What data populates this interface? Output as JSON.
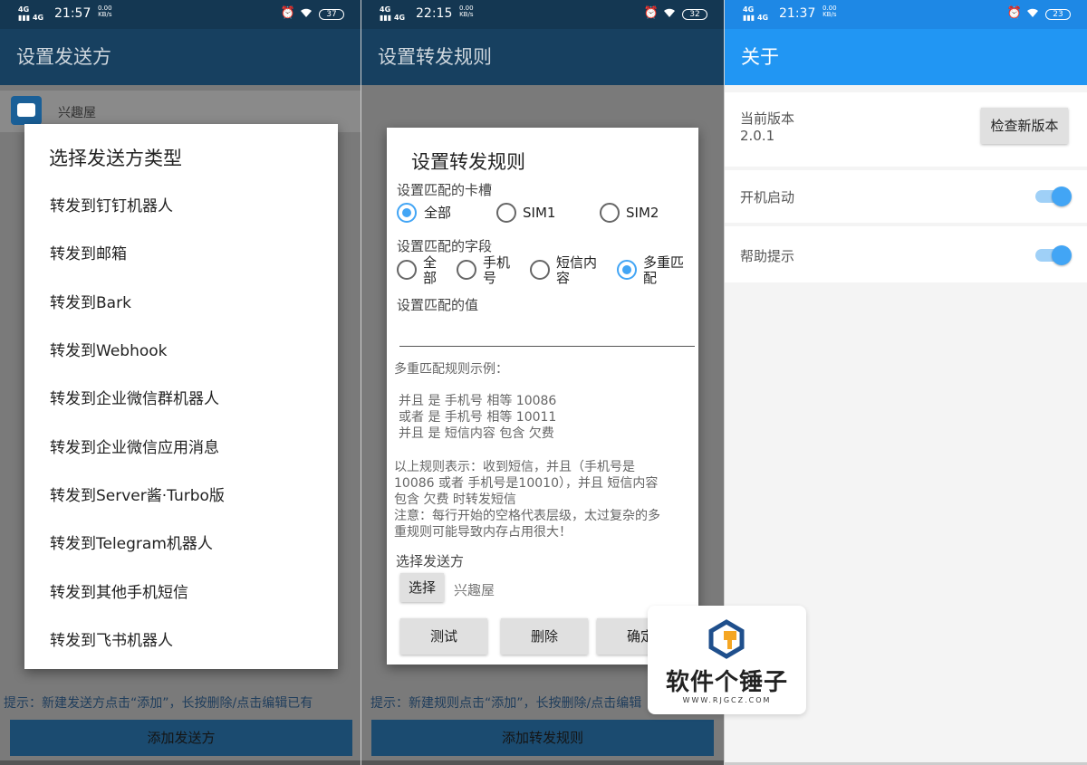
{
  "screen1": {
    "status": {
      "signal": "4G HD",
      "time": "21:57",
      "speed": "0.00",
      "speed_unit": "KB/s",
      "battery": "37"
    },
    "title": "设置发送方",
    "list_row_label": "兴趣屋",
    "dialog": {
      "title": "选择发送方类型",
      "options": [
        "转发到钉钉机器人",
        "转发到邮箱",
        "转发到Bark",
        "转发到Webhook",
        "转发到企业微信群机器人",
        "转发到企业微信应用消息",
        "转发到Server酱·Turbo版",
        "转发到Telegram机器人",
        "转发到其他手机短信",
        "转发到飞书机器人"
      ]
    },
    "hint": "提示：新建发送方点击“添加”，长按删除/点击编辑已有",
    "add_button": "添加发送方"
  },
  "screen2": {
    "status": {
      "signal": "4G HD",
      "time": "22:15",
      "speed": "0.00",
      "speed_unit": "KB/s",
      "battery": "32"
    },
    "title": "设置转发规则",
    "dialog": {
      "title": "设置转发规则",
      "sim_label": "设置匹配的卡槽",
      "sim_options": [
        "全部",
        "SIM1",
        "SIM2"
      ],
      "field_label": "设置匹配的字段",
      "field_options": [
        "全部",
        "手机号",
        "短信内容",
        "多重匹配"
      ],
      "value_label": "设置匹配的值",
      "example_title": "多重匹配规则示例：",
      "example_lines": [
        "并且 是 手机号 相等 10086",
        "或者 是 手机号 相等 10011",
        "并且 是 短信内容 包含 欠费"
      ],
      "explain_lines": [
        " 以上规则表示：收到短信，并且（手机号是",
        "10086 或者 手机号是10010），并且 短信内容",
        "包含 欠费 时转发短信",
        " 注意：每行开始的空格代表层级，太过复杂的多",
        "重规则可能导致内存占用很大！"
      ],
      "sender_label": "选择发送方",
      "select_button": "选择",
      "sender_value": "兴趣屋",
      "buttons": [
        "测试",
        "删除",
        "确定"
      ]
    },
    "hint": "提示：新建规则点击“添加”，长按删除/点击编辑",
    "add_button": "添加转发规则"
  },
  "screen3": {
    "status": {
      "signal": "4G HD",
      "time": "21:37",
      "speed": "0.00",
      "speed_unit": "KB/s",
      "battery": "23"
    },
    "title": "关于",
    "version_label": "当前版本",
    "version_value": "2.0.1",
    "check_button": "检查新版本",
    "boot_label": "开机启动",
    "help_label": "帮助提示"
  },
  "watermark": {
    "name": "软件个锤子",
    "url": "WWW.RJGCZ.COM"
  },
  "colors": {
    "dark_bar": "#174060",
    "blue_bar": "#2196f3",
    "accent": "#42a5f5"
  }
}
